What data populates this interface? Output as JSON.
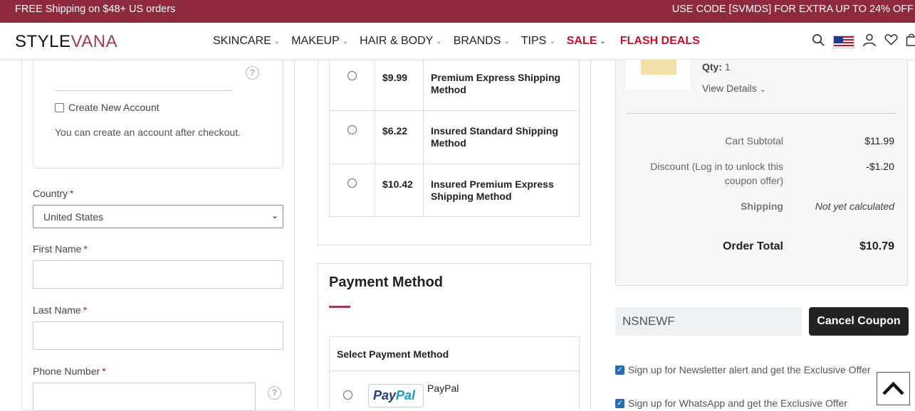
{
  "promo": {
    "left": "FREE Shipping on $48+ US orders",
    "right": "USE CODE [SVMDS] FOR EXTRA UP TO 24% OFF"
  },
  "header": {
    "logo_part1": "STYLE",
    "logo_part2": "VANA",
    "nav": [
      {
        "label": "SKINCARE"
      },
      {
        "label": "MAKEUP"
      },
      {
        "label": "HAIR & BODY"
      },
      {
        "label": "BRANDS"
      },
      {
        "label": "TIPS"
      },
      {
        "label": "SALE"
      },
      {
        "label": "FLASH DEALS"
      }
    ],
    "icons": [
      "search-icon",
      "us-flag-icon",
      "user-icon",
      "heart-icon",
      "cart-icon"
    ]
  },
  "account": {
    "create_label": "Create New Account",
    "hint": "You can create an account after checkout."
  },
  "form": {
    "country_label": "Country",
    "country_value": "United States",
    "first_name_label": "First Name",
    "last_name_label": "Last Name",
    "phone_label": "Phone Number",
    "required_mark": "*"
  },
  "shipping": {
    "rows": [
      {
        "price": "$9.99",
        "method": "Premium Express Shipping Method"
      },
      {
        "price": "$6.22",
        "method": "Insured Standard Shipping Method"
      },
      {
        "price": "$10.42",
        "method": "Insured Premium Express Shipping Method"
      }
    ]
  },
  "payment": {
    "title": "Payment Method",
    "select_label": "Select Payment Method",
    "paypal_logo_part1": "Pay",
    "paypal_logo_part2": "Pal",
    "paypal_label": "PayPal"
  },
  "summary": {
    "qty_label": "Qty:",
    "qty_value": "1",
    "view_details": "View Details",
    "subtotal_label": "Cart Subtotal",
    "subtotal_value": "$11.99",
    "discount_label_line1": "Discount (Log in to unlock this",
    "discount_label_line2": "coupon offer)",
    "discount_value": "-$1.20",
    "shipping_label": "Shipping",
    "shipping_value": "Not yet calculated",
    "total_label": "Order Total",
    "total_value": "$10.79"
  },
  "coupon": {
    "code": "NSNEWF",
    "button": "Cancel Coupon"
  },
  "options": {
    "newsletter": "Sign up for Newsletter alert and get the Exclusive Offer",
    "whatsapp": "Sign up for WhatsApp and get the Exclusive Offer"
  },
  "colors": {
    "brand": "#8f2a3e",
    "sale": "#c8102e"
  }
}
